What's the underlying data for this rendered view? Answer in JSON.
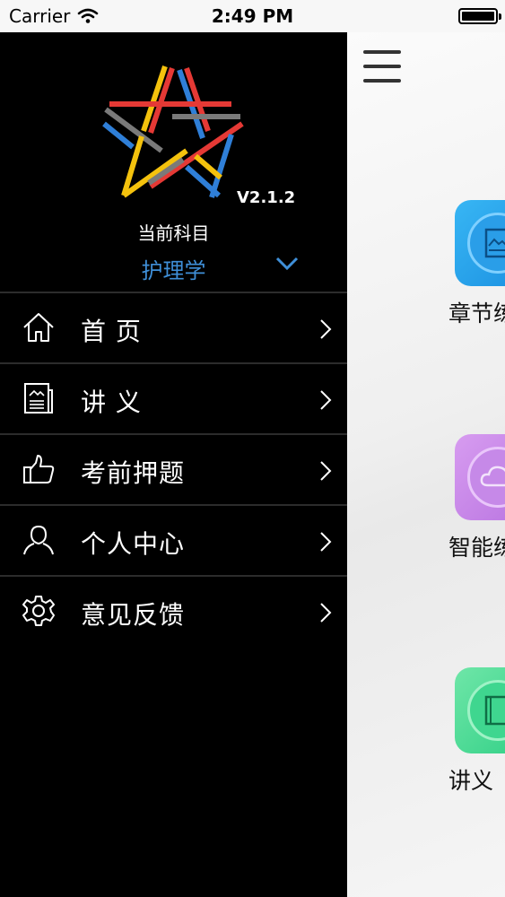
{
  "status_bar": {
    "carrier": "Carrier",
    "time": "2:49 PM"
  },
  "sidebar": {
    "version": "V2.1.2",
    "subject_label": "当前科目",
    "subject_value": "护理学",
    "items": [
      {
        "label": "首 页",
        "icon": "home-icon"
      },
      {
        "label": "讲 义",
        "icon": "document-icon"
      },
      {
        "label": "考前押题",
        "icon": "thumbs-up-icon"
      },
      {
        "label": "个人中心",
        "icon": "user-icon"
      },
      {
        "label": "意见反馈",
        "icon": "gear-icon"
      }
    ]
  },
  "main": {
    "tiles": [
      {
        "label": "章节练",
        "color": "#2a9ee8",
        "icon": "image-doc-icon"
      },
      {
        "label": "智能练",
        "color": "#c689e8",
        "icon": "cloud-icon"
      },
      {
        "label": "讲义",
        "color": "#3fd68f",
        "icon": "book-icon"
      }
    ]
  },
  "colors": {
    "sidebar_bg": "#000000",
    "accent": "#3f8fd8",
    "logo_red": "#e53935",
    "logo_yellow": "#f4c20d",
    "logo_blue": "#2f7fd8",
    "logo_gray": "#7a7a7a"
  }
}
